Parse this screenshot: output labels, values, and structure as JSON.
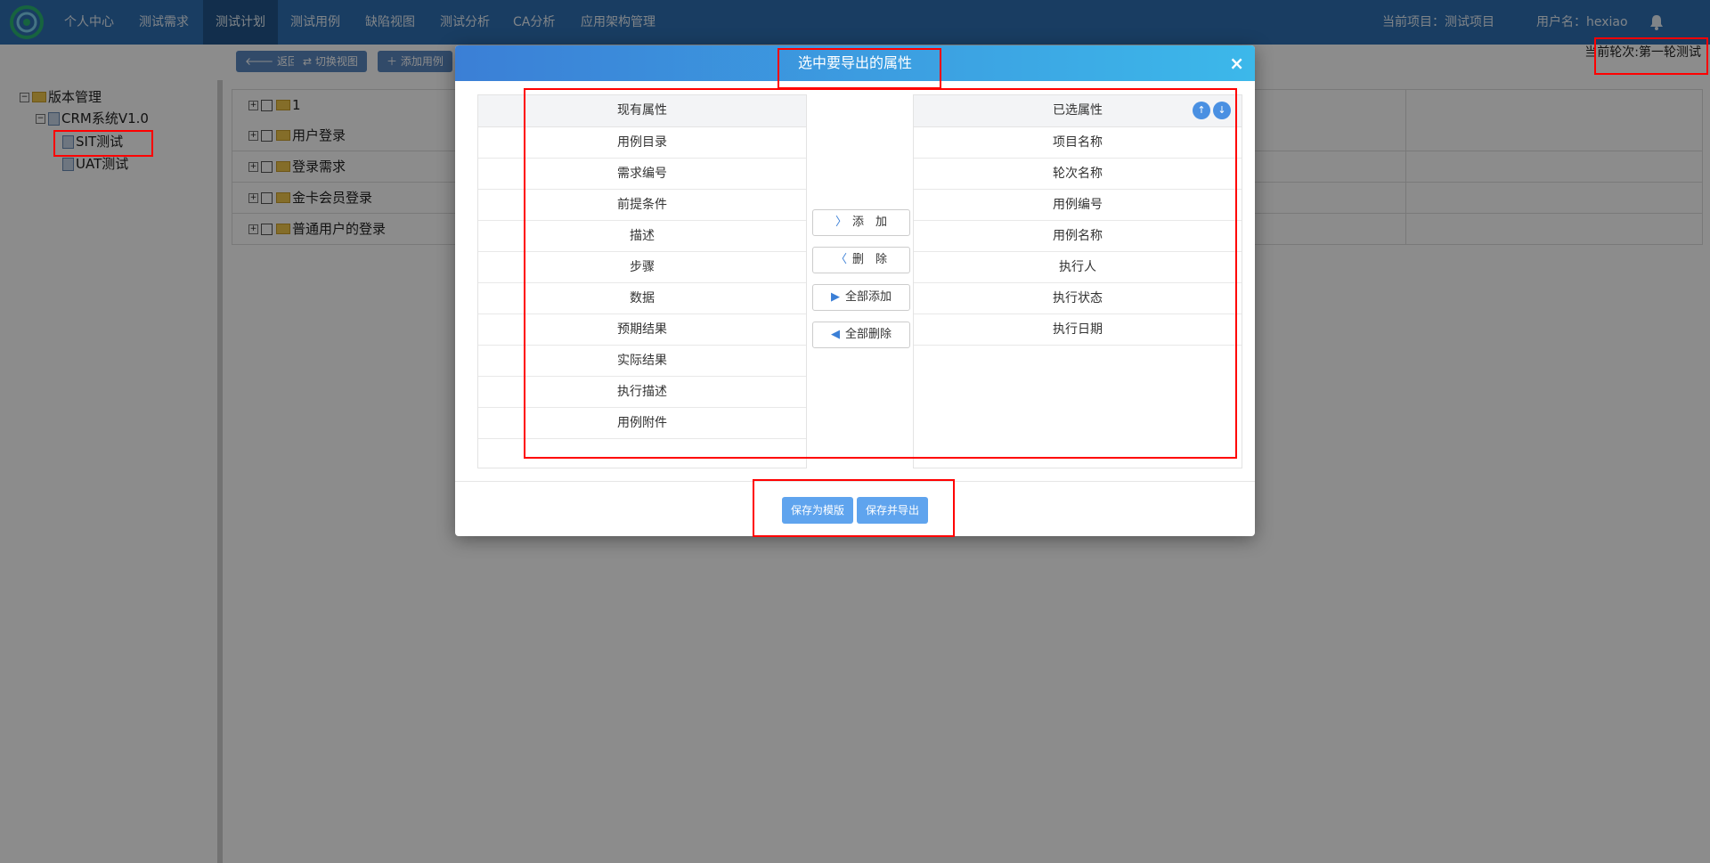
{
  "nav": {
    "items": [
      "个人中心",
      "测试需求",
      "测试计划",
      "测试用例",
      "缺陷视图",
      "测试分析",
      "CA分析",
      "应用架构管理"
    ],
    "active_index": 2,
    "current_project": "当前项目：测试项目",
    "username": "用户名：hexiao"
  },
  "toolbar": {
    "back": "返回",
    "switch_view": "切换视图",
    "add_case": "添加用例",
    "current_round": "当前轮次:第一轮测试"
  },
  "tree": {
    "root": "版本管理",
    "project": "CRM系统V1.0",
    "children": [
      "SIT测试",
      "UAT测试"
    ]
  },
  "main_rows": [
    "1",
    "用户登录",
    "登录需求",
    "金卡会员登录",
    "普通用户的登录"
  ],
  "modal": {
    "title": "选中要导出的属性",
    "close": "×",
    "available_header": "现有属性",
    "available": [
      "用例目录",
      "需求编号",
      "前提条件",
      "描述",
      "步骤",
      "数据",
      "预期结果",
      "实际结果",
      "执行描述",
      "用例附件"
    ],
    "selected_header": "已选属性",
    "selected": [
      "项目名称",
      "轮次名称",
      "用例编号",
      "用例名称",
      "执行人",
      "执行状态",
      "执行日期"
    ],
    "buttons": {
      "add": "添　加",
      "remove": "删　除",
      "add_all": "全部添加",
      "remove_all": "全部删除"
    },
    "save_template": "保存为模版",
    "save_export": "保存并导出"
  },
  "colors": {
    "nav_bg": "#2f6fb3",
    "modal_head_start": "#3b7fd6",
    "modal_head_end": "#3cb8ea",
    "annotation": "#ff0000"
  }
}
